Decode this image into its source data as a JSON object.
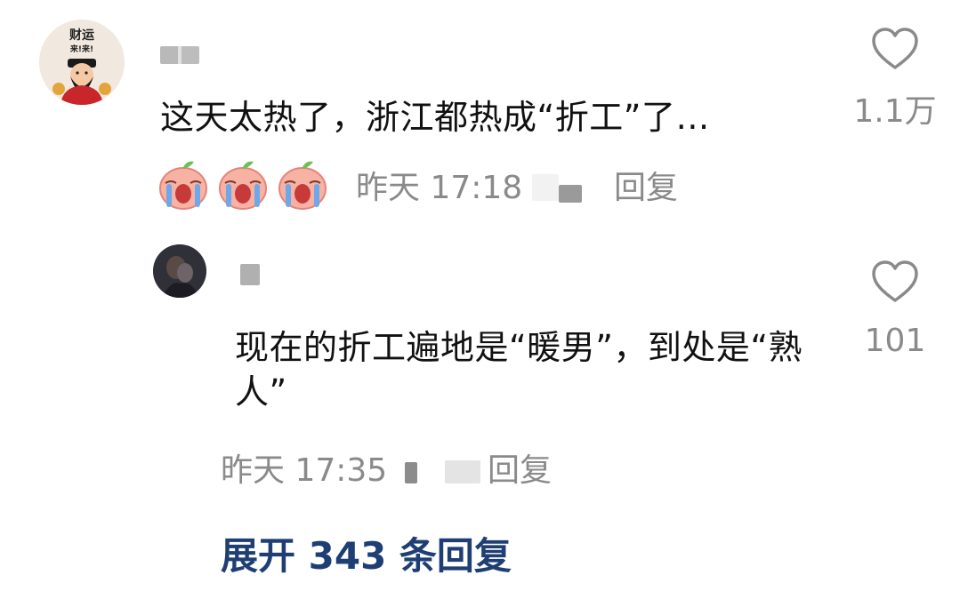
{
  "comment": {
    "avatar_text_top": "财运",
    "avatar_text_mid": "来!来!",
    "text": "这天太热了，浙江都热成“折工”了…",
    "emojis": [
      "crying-peach-emoji",
      "crying-peach-emoji",
      "crying-peach-emoji"
    ],
    "time": "昨天 17:18",
    "reply_label": "回复",
    "likes": "1.1万"
  },
  "reply": {
    "text": "现在的折工遍地是“暖男”，到处是“熟人”",
    "time": "昨天 17:35",
    "reply_label": "回复",
    "likes": "101"
  },
  "expand": {
    "label": "展开 343 条回复"
  },
  "colors": {
    "link": "#1f3e73",
    "meta": "#8a8a8a",
    "text": "#111111"
  },
  "icons": {
    "like": "heart-outline-icon"
  }
}
